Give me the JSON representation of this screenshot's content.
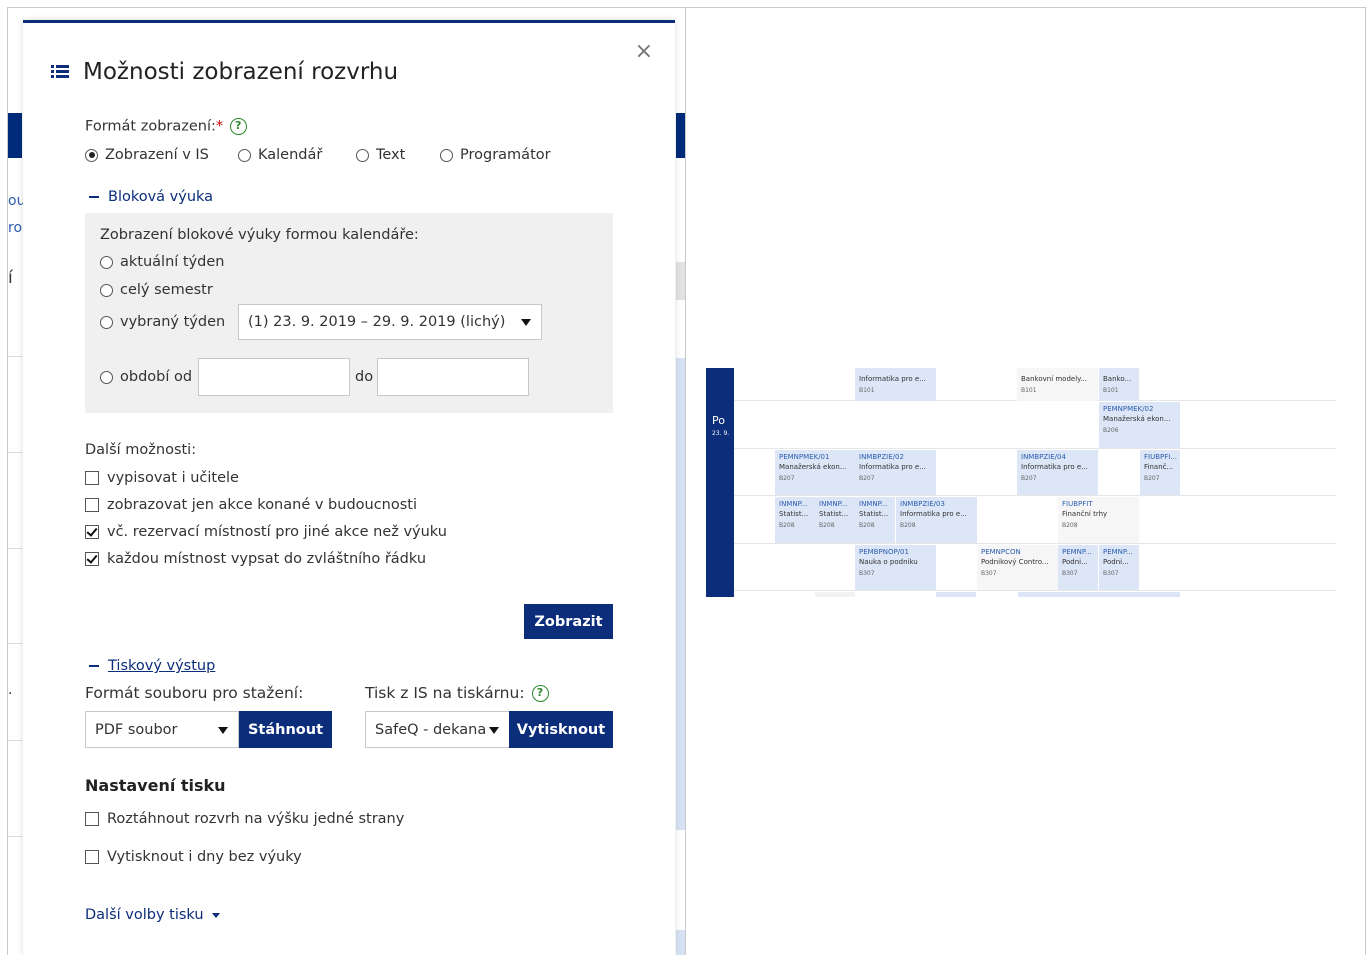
{
  "background": {
    "fragments": [
      "ou",
      "ro",
      "í",
      "."
    ]
  },
  "modal": {
    "title": "Možnosti zobrazení rozvrhu",
    "close": "×",
    "format_label": "Formát zobrazení:",
    "required_mark": "*",
    "help": "?",
    "formats": [
      {
        "label": "Zobrazení v IS",
        "selected": true
      },
      {
        "label": "Kalendář",
        "selected": false
      },
      {
        "label": "Text",
        "selected": false
      },
      {
        "label": "Programátor",
        "selected": false
      }
    ],
    "block": {
      "link": "Bloková výuka",
      "heading": "Zobrazení blokové výuky formou kalendáře:",
      "current_week": "aktuální týden",
      "whole_semester": "celý semestr",
      "selected_week": "vybraný týden",
      "week_select": "(1)   23. 9. 2019 – 29. 9. 2019   (lichý)",
      "period_from": "období od",
      "period_to": "do",
      "from_value": "",
      "to_value": ""
    },
    "other": {
      "heading": "Další možnosti:",
      "options": [
        {
          "label": "vypisovat i učitele",
          "checked": false
        },
        {
          "label": "zobrazovat jen akce konané v budoucnosti",
          "checked": false
        },
        {
          "label": "vč. rezervací místností pro jiné akce než výuku",
          "checked": true
        },
        {
          "label": "každou místnost vypsat do zvláštního řádku",
          "checked": true
        }
      ]
    },
    "show_button": "Zobrazit",
    "print": {
      "link": "Tiskový výstup",
      "file_format_label": "Formát souboru pro stažení:",
      "file_format_value": "PDF soubor",
      "download_button": "Stáhnout",
      "printer_label": "Tisk z IS na tiskárnu:",
      "printer_value": "SafeQ - dekana",
      "print_button": "Vytisknout"
    },
    "print_settings": {
      "heading": "Nastavení tisku",
      "options": [
        {
          "label": "Roztáhnout rozvrh na výšku jedné strany",
          "checked": false
        },
        {
          "label": "Vytisknout i dny bez výuky",
          "checked": false
        }
      ],
      "more": "Další volby tisku"
    }
  },
  "timetable": {
    "day": "Po",
    "date": "23. 9.",
    "rows": [
      [
        {
          "code": "",
          "name": "Informatika pro e...",
          "room": "B101"
        },
        {
          "code": "",
          "name": "Bankovní modely...",
          "room": "B101"
        },
        {
          "code": "",
          "name": "Banko...",
          "room": "B101"
        }
      ],
      [
        {
          "code": "PEMNPMEK/02",
          "name": "Manažerská ekon...",
          "room": "B206"
        }
      ],
      [
        {
          "code": "PEMNPMEK/01",
          "name": "Manažerská ekon...",
          "room": "B207"
        },
        {
          "code": "INMBPZIE/02",
          "name": "Informatika pro e...",
          "room": "B207"
        },
        {
          "code": "INMBPZIE/04",
          "name": "Informatika pro e...",
          "room": "B207"
        },
        {
          "code": "FIUBPFI...",
          "name": "Finanč...",
          "room": "B207"
        }
      ],
      [
        {
          "code": "INMNP...",
          "name": "Statist...",
          "room": "B208"
        },
        {
          "code": "INMNP...",
          "name": "Statist...",
          "room": "B208"
        },
        {
          "code": "INMNP...",
          "name": "Statist...",
          "room": "B208"
        },
        {
          "code": "INMBPZIE/03",
          "name": "Informatika pro e...",
          "room": "B208"
        },
        {
          "code": "FIUBPFIT",
          "name": "Finanční trhy",
          "room": "B208"
        }
      ],
      [
        {
          "code": "PEMBPNOP/01",
          "name": "Nauka o podniku",
          "room": "B307"
        },
        {
          "code": "PEMNPCON",
          "name": "Podnikový Contro...",
          "room": "B307"
        },
        {
          "code": "PEMNP...",
          "name": "Podni...",
          "room": "B307"
        },
        {
          "code": "PEMNP...",
          "name": "Podni...",
          "room": "B307"
        }
      ]
    ]
  }
}
